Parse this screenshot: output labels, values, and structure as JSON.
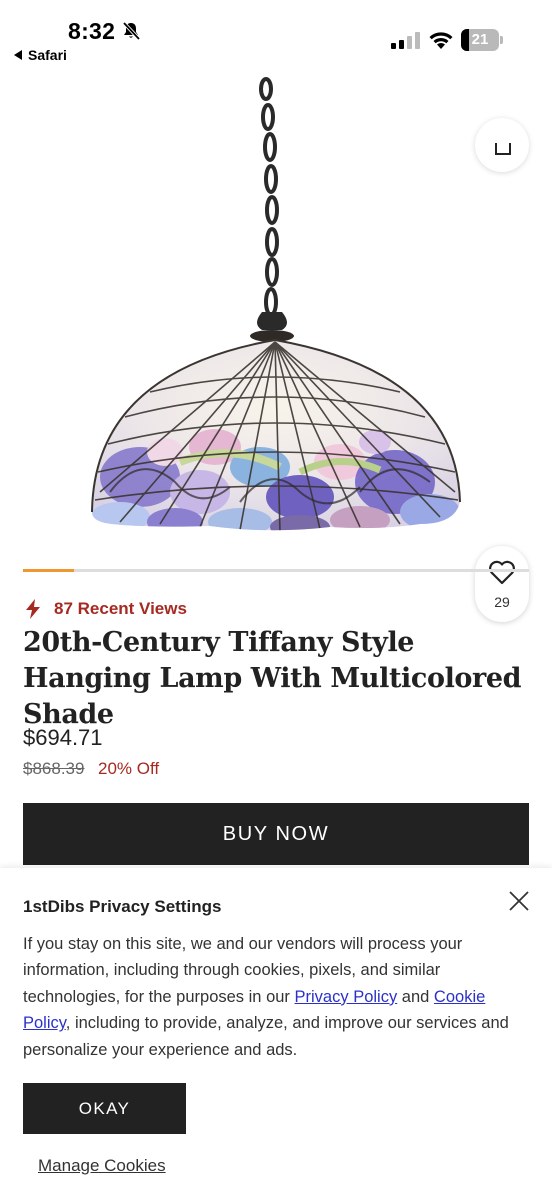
{
  "status_bar": {
    "time": "8:32",
    "back_app": "Safari",
    "battery_level": "21",
    "battery_fraction": 0.21
  },
  "hero": {
    "favorite_count": "29",
    "carousel_progress": 0.1
  },
  "product": {
    "recent_views": "87 Recent Views",
    "title": "20th-Century Tiffany Style Hanging Lamp With Multicolored Shade",
    "price": "$694.71",
    "original_price": "$868.39",
    "discount": "20% Off",
    "buy_now_label": "BUY NOW"
  },
  "privacy": {
    "title": "1stDibs Privacy Settings",
    "text_part1": "If you stay on this site, we and our vendors will process your information, including through cookies, pixels, and similar technologies, for the purposes in our ",
    "privacy_policy_link": "Privacy Policy",
    "text_part2": " and ",
    "cookie_policy_link": "Cookie Policy",
    "text_part3": ", including to provide, analyze, and improve our services and personalize your experience and ads.",
    "okay_label": "OKAY",
    "manage_cookies_label": "Manage Cookies"
  },
  "colors": {
    "accent_red": "#a52a22",
    "carousel_orange": "#f0962f",
    "link_blue": "#2b31c8",
    "button_dark": "#222222"
  }
}
